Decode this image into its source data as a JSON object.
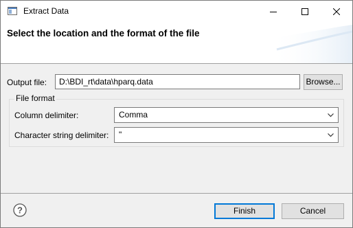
{
  "window": {
    "title": "Extract Data",
    "minimize_icon": "minimize-icon",
    "maximize_icon": "maximize-icon",
    "close_icon": "close-icon"
  },
  "header": {
    "title": "Select the location and the format of the file"
  },
  "output": {
    "label": "Output file:",
    "value": "D:\\BDI_rt\\data\\hparq.data",
    "browse_label": "Browse..."
  },
  "file_format": {
    "group_label": "File format",
    "column_delimiter_label": "Column delimiter:",
    "column_delimiter_value": "Comma",
    "string_delimiter_label": "Character string delimiter:",
    "string_delimiter_value": "\""
  },
  "footer": {
    "help_icon": "help-icon",
    "finish_label": "Finish",
    "cancel_label": "Cancel"
  }
}
